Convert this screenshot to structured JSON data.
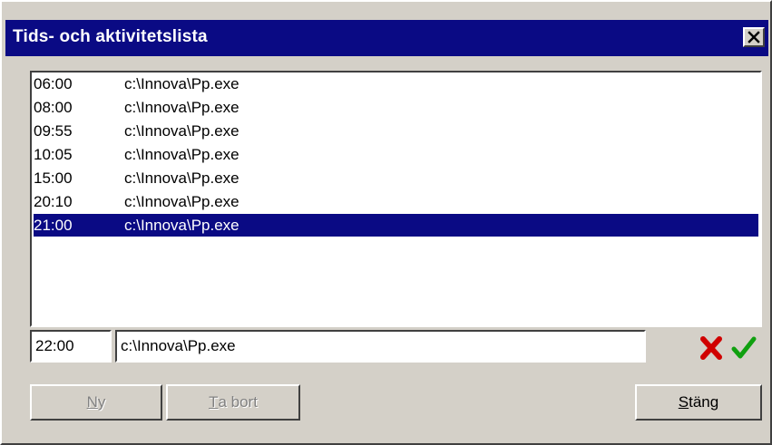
{
  "window": {
    "title": "Tids- och aktivitetslista"
  },
  "icons": {
    "close": "close-icon",
    "cancel": "red-x-icon",
    "confirm": "green-check-icon"
  },
  "colors": {
    "titlebar": "#0a0a84",
    "selection": "#0a0a84",
    "cancel": "#d00000",
    "confirm": "#10a010"
  },
  "list": {
    "items": [
      {
        "time": "06:00",
        "path": "c:\\Innova\\Pp.exe"
      },
      {
        "time": "08:00",
        "path": "c:\\Innova\\Pp.exe"
      },
      {
        "time": "09:55",
        "path": "c:\\Innova\\Pp.exe"
      },
      {
        "time": "10:05",
        "path": "c:\\Innova\\Pp.exe"
      },
      {
        "time": "15:00",
        "path": "c:\\Innova\\Pp.exe"
      },
      {
        "time": "20:10",
        "path": "c:\\Innova\\Pp.exe"
      },
      {
        "time": "21:00",
        "path": "c:\\Innova\\Pp.exe"
      }
    ],
    "selected_index": 6
  },
  "edit": {
    "time": "22:00",
    "path": "c:\\Innova\\Pp.exe"
  },
  "buttons": {
    "new": {
      "accel": "N",
      "rest": "y"
    },
    "delete": {
      "accel": "T",
      "rest": "a bort"
    },
    "close": {
      "accel": "S",
      "rest": "täng"
    }
  }
}
